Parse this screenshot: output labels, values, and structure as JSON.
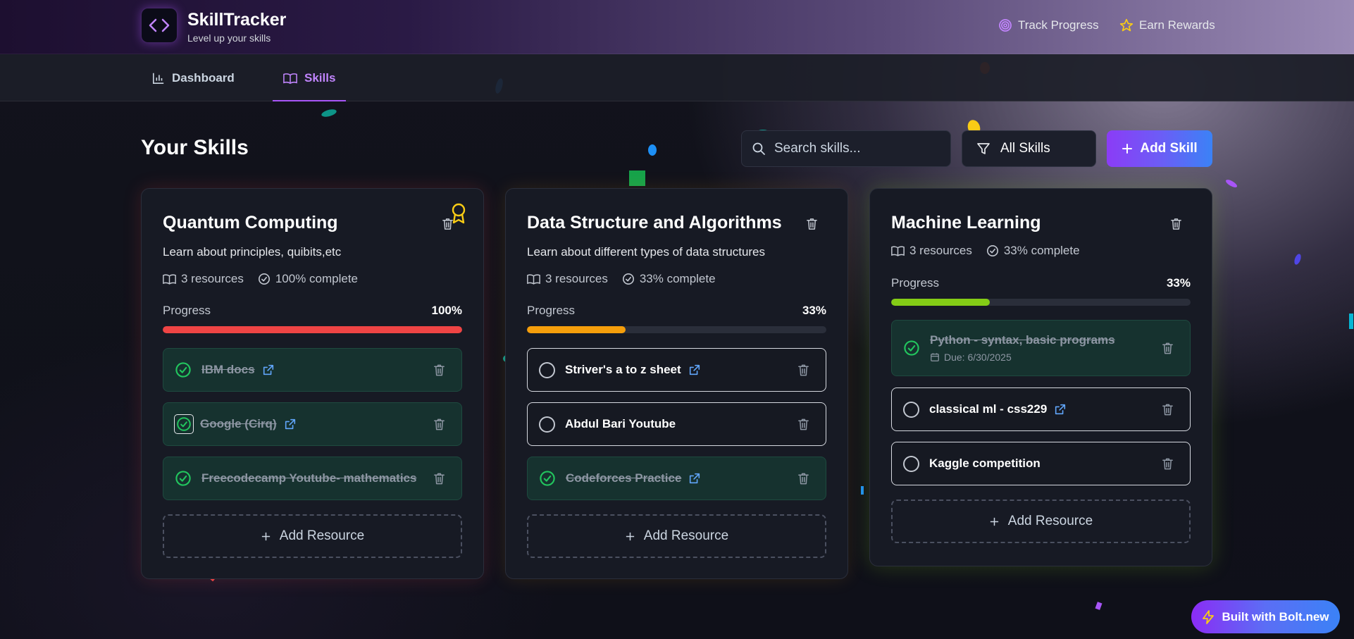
{
  "app": {
    "title": "SkillTracker",
    "subtitle": "Level up your skills",
    "header_links": [
      {
        "label": "Track Progress",
        "icon": "target-icon"
      },
      {
        "label": "Earn Rewards",
        "icon": "star-icon"
      }
    ]
  },
  "nav": {
    "tabs": [
      {
        "label": "Dashboard",
        "icon": "bar-chart-icon",
        "active": false
      },
      {
        "label": "Skills",
        "icon": "book-open-icon",
        "active": true
      }
    ]
  },
  "toolbar": {
    "page_title": "Your Skills",
    "search_placeholder": "Search skills...",
    "filter_label": "All Skills",
    "add_skill_label": "Add Skill"
  },
  "skills": [
    {
      "title": "Quantum Computing",
      "description": "Learn about principles, quibits,etc",
      "resources_text": "3 resources",
      "complete_text": "100% complete",
      "progress_label": "Progress",
      "progress_text": "100%",
      "progress": 1.0,
      "progress_color": "#ef4444",
      "award": true,
      "resources": [
        {
          "name": "IBM docs",
          "done": true,
          "link": true
        },
        {
          "name": "Google (Cirq)",
          "done": true,
          "link": true
        },
        {
          "name": "Freecodecamp Youtube- mathematics",
          "done": true,
          "link": false
        }
      ],
      "add_resource_label": "Add Resource"
    },
    {
      "title": "Data Structure and Algorithms",
      "description": "Learn about different types of data structures",
      "resources_text": "3 resources",
      "complete_text": "33% complete",
      "progress_label": "Progress",
      "progress_text": "33%",
      "progress": 0.33,
      "progress_color": "#f59e0b",
      "award": false,
      "resources": [
        {
          "name": "Striver's a to z sheet",
          "done": false,
          "link": true
        },
        {
          "name": "Abdul Bari Youtube",
          "done": false,
          "link": false
        },
        {
          "name": "Codeforces Practice",
          "done": true,
          "link": true
        }
      ],
      "add_resource_label": "Add Resource"
    },
    {
      "title": "Machine Learning",
      "description": "",
      "resources_text": "3 resources",
      "complete_text": "33% complete",
      "progress_label": "Progress",
      "progress_text": "33%",
      "progress": 0.33,
      "progress_color": "#84cc16",
      "award": false,
      "resources": [
        {
          "name": "Python - syntax, basic programs",
          "done": true,
          "link": false,
          "due": "Due: 6/30/2025"
        },
        {
          "name": "classical ml - css229",
          "done": false,
          "link": true
        },
        {
          "name": "Kaggle competition",
          "done": false,
          "link": false
        }
      ],
      "add_resource_label": "Add Resource"
    }
  ],
  "badge": {
    "label": "Built with Bolt.new",
    "icon": "lightning-icon"
  },
  "colors": {
    "accent": "#a855f7",
    "done_green": "#22c55e",
    "link_blue": "#60a5fa"
  }
}
